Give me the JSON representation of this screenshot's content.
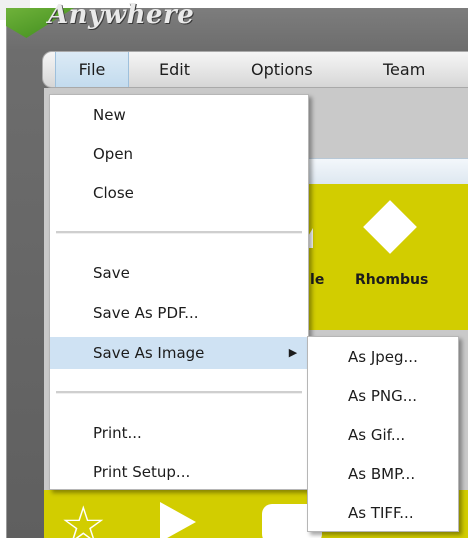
{
  "app": {
    "logo_text": "Anywhere"
  },
  "menubar": {
    "items": [
      {
        "label": "File"
      },
      {
        "label": "Edit"
      },
      {
        "label": "Options"
      },
      {
        "label": "Team"
      }
    ],
    "active_index": 0
  },
  "background": {
    "shapes": {
      "triangle_label": "gle",
      "rhombus_label": "Rhombus"
    }
  },
  "file_menu": {
    "items": [
      {
        "label": "New"
      },
      {
        "label": "Open"
      },
      {
        "label": "Close"
      },
      {
        "label": "Save"
      },
      {
        "label": "Save As PDF..."
      },
      {
        "label": "Save As Image",
        "has_submenu": true
      },
      {
        "label": "Print..."
      },
      {
        "label": "Print Setup..."
      }
    ],
    "highlighted_item": "Save As Image",
    "submenu_arrow_icon": "triangle-right-icon"
  },
  "save_as_image_submenu": {
    "items": [
      {
        "label": "As Jpeg..."
      },
      {
        "label": "As PNG..."
      },
      {
        "label": "As Gif..."
      },
      {
        "label": "As BMP..."
      },
      {
        "label": "As TIFF..."
      }
    ]
  },
  "colors": {
    "menu_highlight": "#cfe2f3",
    "shape_panel": "#d2cd00",
    "chrome_grey": "#6d6d6d"
  }
}
